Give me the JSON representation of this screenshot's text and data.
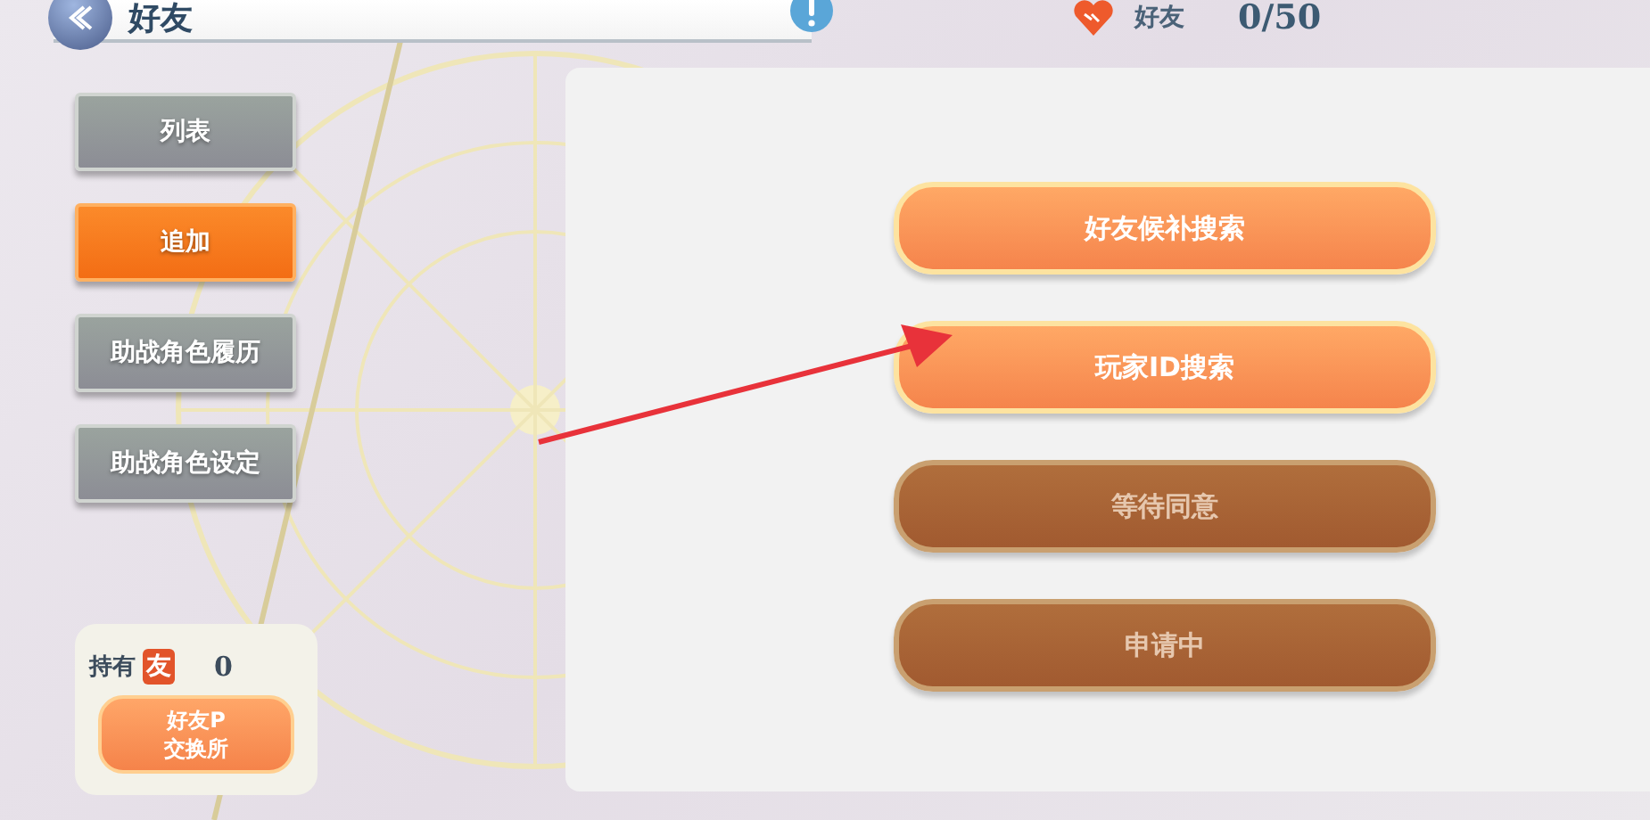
{
  "header": {
    "title": "好友",
    "friends_label": "好友",
    "friends_count": "0/50"
  },
  "nav": [
    {
      "label": "列表",
      "selected": false
    },
    {
      "label": "追加",
      "selected": true
    },
    {
      "label": "助战角色履历",
      "selected": false
    },
    {
      "label": "助战角色设定",
      "selected": false
    }
  ],
  "points": {
    "label": "持有",
    "badge": "友",
    "count": "0",
    "exchange_button": "好友P\n交换所"
  },
  "actions": [
    {
      "label": "好友候补搜索",
      "disabled": false
    },
    {
      "label": "玩家ID搜索",
      "disabled": false
    },
    {
      "label": "等待同意",
      "disabled": true
    },
    {
      "label": "申请中",
      "disabled": true
    }
  ]
}
